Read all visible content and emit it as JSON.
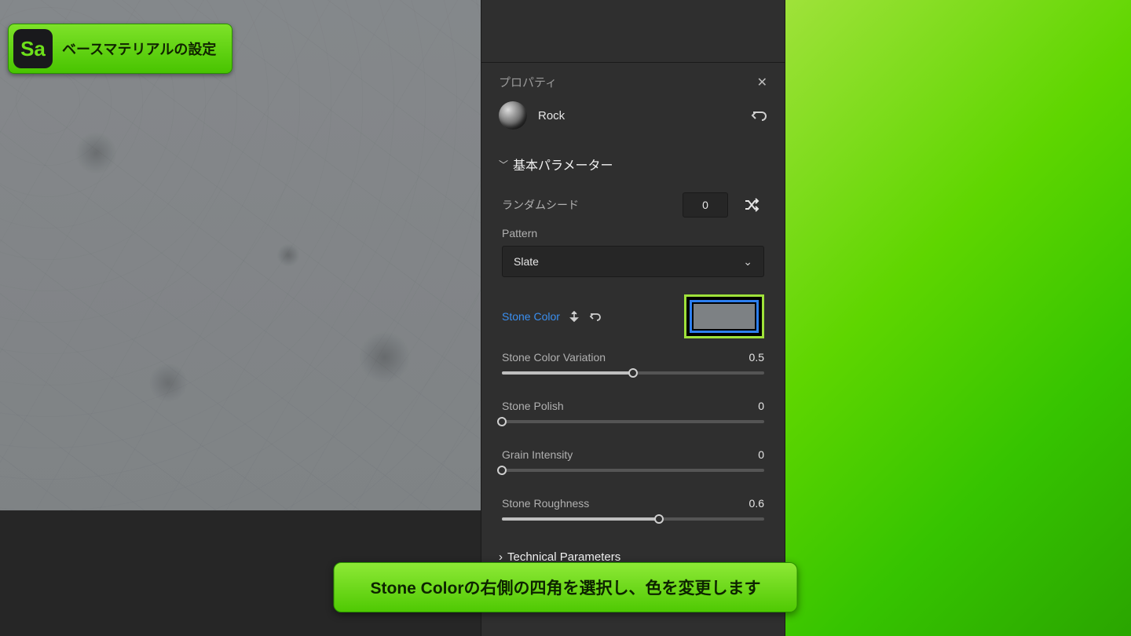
{
  "badge": {
    "logo": "Sa",
    "title": "ベースマテリアルの設定"
  },
  "panel": {
    "header": "プロパティ",
    "material_name": "Rock",
    "section_basic": "基本パラメーター",
    "random_seed_label": "ランダムシード",
    "random_seed_value": "0",
    "pattern_label": "Pattern",
    "pattern_value": "Slate",
    "stone_color_label": "Stone Color",
    "stone_color_swatch": "#7d8184",
    "sliders": [
      {
        "label": "Stone Color Variation",
        "value": "0.5",
        "pct": 50
      },
      {
        "label": "Stone Polish",
        "value": "0",
        "pct": 0
      },
      {
        "label": "Grain Intensity",
        "value": "0",
        "pct": 0
      },
      {
        "label": "Stone Roughness",
        "value": "0.6",
        "pct": 60
      }
    ],
    "section_technical": "Technical Parameters"
  },
  "caption": "Stone Colorの右側の四角を選択し、色を変更します"
}
